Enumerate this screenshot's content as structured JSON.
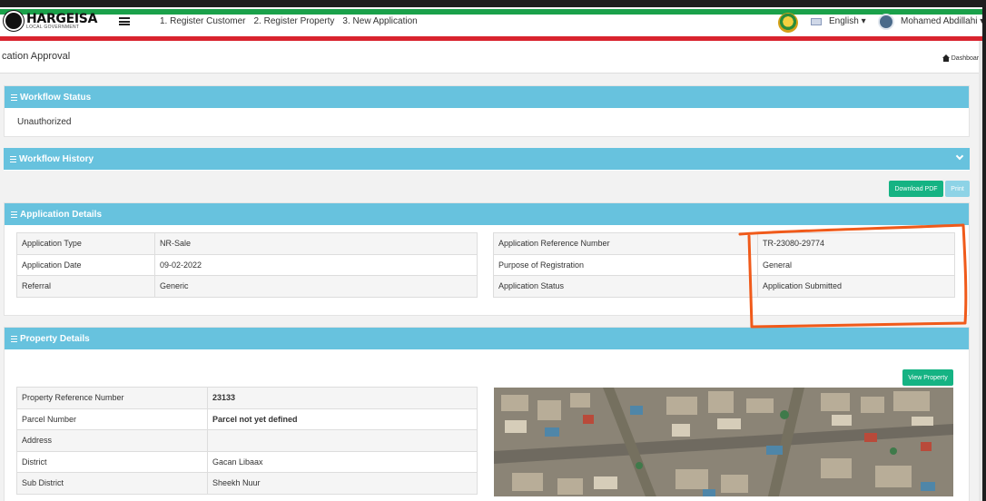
{
  "brand": {
    "title": "HARGEISA",
    "subtitle": "LOCAL GOVERNMENT"
  },
  "nav": {
    "items": [
      "1. Register Customer",
      "2. Register Property",
      "3. New Application"
    ]
  },
  "header_right": {
    "language": "English",
    "user": "Mohamed Abdillahi"
  },
  "page": {
    "title": "cation Approval",
    "breadcrumb": "Dashboard"
  },
  "workflow_status": {
    "header": "Workflow Status",
    "value": "Unauthorized"
  },
  "workflow_history": {
    "header": "Workflow History"
  },
  "buttons": {
    "download_pdf": "Download PDF",
    "print": "Print",
    "view_property": "View Property"
  },
  "application_details": {
    "header": "Application Details",
    "left": [
      {
        "label": "Application Type",
        "value": "NR-Sale"
      },
      {
        "label": "Application Date",
        "value": "09-02-2022"
      },
      {
        "label": "Referral",
        "value": "Generic"
      }
    ],
    "right": [
      {
        "label": "Application Reference Number",
        "value": "TR-23080-29774"
      },
      {
        "label": "Purpose of Registration",
        "value": "General"
      },
      {
        "label": "Application Status",
        "value": "Application Submitted"
      }
    ]
  },
  "property_details": {
    "header": "Property Details",
    "rows": [
      {
        "label": "Property Reference Number",
        "value": "23133"
      },
      {
        "label": "Parcel Number",
        "value": "Parcel not yet defined"
      },
      {
        "label": "Address",
        "value": ""
      },
      {
        "label": "District",
        "value": "Gacan Libaax"
      },
      {
        "label": "Sub District",
        "value": "Sheekh Nuur"
      }
    ]
  },
  "colors": {
    "panel_header": "#67c2de",
    "button_green": "#15b383",
    "annotation": "#f05a1a",
    "flag_green": "#1aa14a",
    "flag_red": "#d9232e"
  }
}
